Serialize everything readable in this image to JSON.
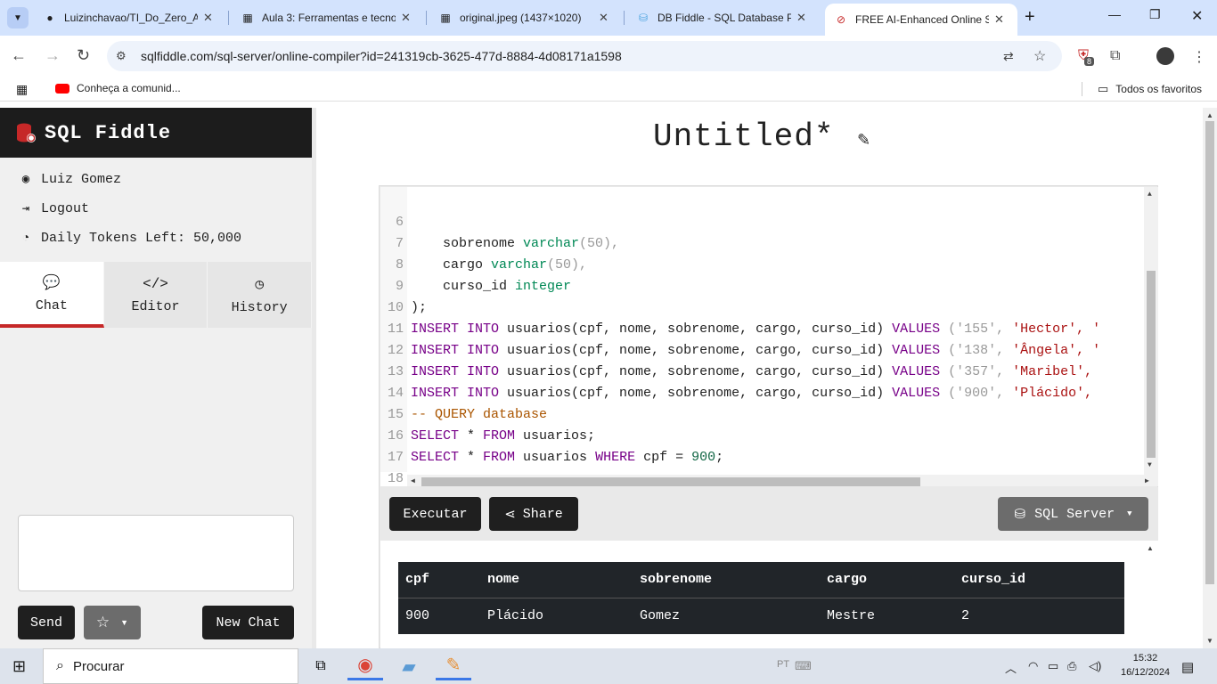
{
  "browser": {
    "tabs": [
      {
        "title": "Luizinchavao/TI_Do_Zero_Ac",
        "icon": "github-icon"
      },
      {
        "title": "Aula 3: Ferramentas e tecnol",
        "icon": "classroom-icon"
      },
      {
        "title": "original.jpeg (1437×1020)",
        "icon": "image-icon"
      },
      {
        "title": "DB Fiddle - SQL Database Pl",
        "icon": "database-icon"
      },
      {
        "title": "FREE AI-Enhanced Online SQ",
        "icon": "sqlfiddle-icon"
      }
    ],
    "url": "sqlfiddle.com/sql-server/online-compiler?id=241319cb-3625-477d-8884-4d08171a1598",
    "extension_badge": "8",
    "bookmarks": {
      "item": "Conheça a comunid...",
      "all": "Todos os favoritos"
    }
  },
  "sidebar": {
    "brand": "SQL Fiddle",
    "user": "Luiz Gomez",
    "logout": "Logout",
    "tokens": "Daily Tokens Left: 50,000",
    "tabs": [
      {
        "label": "Chat",
        "icon": "chat-icon"
      },
      {
        "label": "Editor",
        "icon": "code-icon"
      },
      {
        "label": "History",
        "icon": "history-icon"
      }
    ],
    "send": "Send",
    "new_chat": "New Chat"
  },
  "main": {
    "title": "Untitled*",
    "run": "Executar",
    "share": "Share",
    "dialect": "SQL Server"
  },
  "editor": {
    "lines": [
      {
        "n": "6"
      },
      {
        "n": "7"
      },
      {
        "n": "8"
      },
      {
        "n": "9"
      },
      {
        "n": "10"
      },
      {
        "n": "11"
      },
      {
        "n": "12"
      },
      {
        "n": "13"
      },
      {
        "n": "14"
      },
      {
        "n": "15"
      },
      {
        "n": "16"
      },
      {
        "n": "17"
      },
      {
        "n": "18"
      }
    ],
    "code": {
      "l6": {
        "a": "    sobrenome ",
        "b": "varchar",
        "c": "(50),"
      },
      "l7": {
        "a": "    cargo ",
        "b": "varchar",
        "c": "(50),"
      },
      "l8": {
        "a": "    curso_id ",
        "b": "integer"
      },
      "l9": ");",
      "insert_kw": "INSERT INTO",
      "values_kw": "VALUES",
      "insert_cols": " usuarios(cpf, nome, sobrenome, cargo, curso_id) ",
      "l10_vals": {
        "a": "('155', ",
        "b": "'Hector', ",
        "c": "'"
      },
      "l11_vals": {
        "a": "('138', ",
        "b": "'Ângela', ",
        "c": "'"
      },
      "l12_vals": {
        "a": "('357', ",
        "b": "'Maribel',"
      },
      "l13_vals": {
        "a": "('900', ",
        "b": "'Plácido',"
      },
      "l14": "-- QUERY database",
      "select_kw": "SELECT",
      "from_kw": "FROM",
      "where_kw": "WHERE",
      "l15_rest": " usuarios;",
      "l16_rest": " usuarios ",
      "l16_cond": " cpf = ",
      "l16_num": "900",
      "star": " * "
    }
  },
  "results": {
    "headers": [
      "cpf",
      "nome",
      "sobrenome",
      "cargo",
      "curso_id"
    ],
    "rows": [
      [
        "900",
        "Plácido",
        "Gomez",
        "Mestre",
        "2"
      ]
    ]
  },
  "taskbar": {
    "search": "Procurar",
    "lang": "PT",
    "time": "15:32",
    "date": "16/12/2024"
  },
  "colors": {
    "brand_dark": "#1c1c1c",
    "active_tab_accent": "#c62828",
    "keyword": "#770088",
    "type": "#008855"
  }
}
